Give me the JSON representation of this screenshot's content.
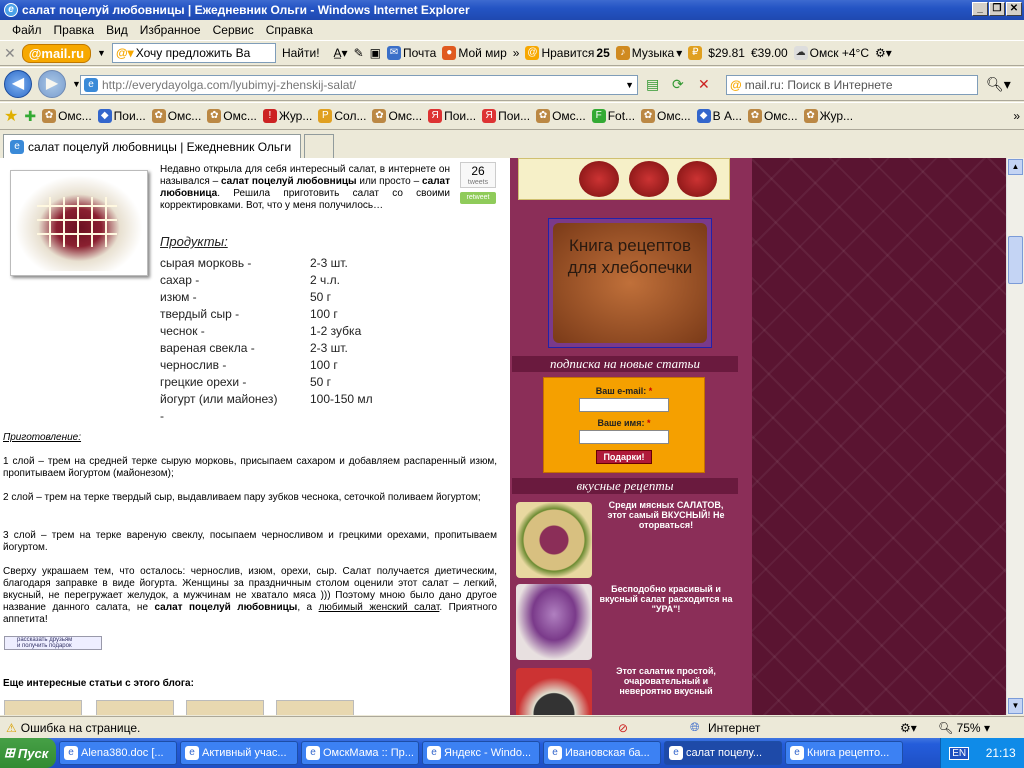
{
  "window": {
    "title": "салат поцелуй любовницы | Ежедневник Ольги - Windows Internet Explorer",
    "minimize": "_",
    "maximize": "❐",
    "close": "✕"
  },
  "menu": [
    "Файл",
    "Правка",
    "Вид",
    "Избранное",
    "Сервис",
    "Справка"
  ],
  "mailbar": {
    "logo": "@mail.ru",
    "search_value": "Хочу предложить Ва",
    "find": "Найти!",
    "pochta": "Почта",
    "moi_mir": "Мой мир",
    "nravitsya": "Нравится",
    "nravitsya_count": "25",
    "muzyka": "Музыка",
    "usd": "$29.81",
    "eur": "€39.00",
    "weather": "Омск +4°C"
  },
  "address": {
    "url_host": "http://everydayolga.com/",
    "url_path": "lyubimyj-zhenskij-salat/",
    "search_placeholder": "mail.ru: Поиск в Интернете"
  },
  "favorites": [
    "Омс...",
    "Пои...",
    "Омс...",
    "Омс...",
    "Жур...",
    "Сол...",
    "Омс...",
    "Пои...",
    "Пои...",
    "Омс...",
    "Fot...",
    "Омс...",
    "В А...",
    "Омс...",
    "Жур..."
  ],
  "tab": {
    "label": "салат поцелуй любовницы | Ежедневник Ольги"
  },
  "article": {
    "intro_a": "Недавно открыла для себя интересный салат, в интернете он назывался – ",
    "intro_b": "салат поцелуй любовницы",
    "intro_c": " или просто – ",
    "intro_d": "салат любовница",
    "intro_e": ". Решила приготовить салат со своими корректировками. Вот, что у меня получилось…",
    "tweet_count": "26",
    "tweet_unit": "tweets",
    "retweet": "retweet",
    "products_title": "Продукты:",
    "products": [
      {
        "name": "сырая морковь -",
        "amount": "2-3 шт."
      },
      {
        "name": "сахар -",
        "amount": "2 ч.л."
      },
      {
        "name": "изюм -",
        "amount": "50 г"
      },
      {
        "name": "твердый сыр -",
        "amount": "100 г"
      },
      {
        "name": "чеснок -",
        "amount": "1-2 зубка"
      },
      {
        "name": "вареная свекла -",
        "amount": "2-3 шт."
      },
      {
        "name": "чернослив -",
        "amount": "100 г"
      },
      {
        "name": "грецкие орехи -",
        "amount": "50 г"
      },
      {
        "name": "йогурт (или майонез)",
        "amount": "100-150 мл"
      },
      {
        "name": "-",
        "amount": ""
      }
    ],
    "prep_title": "Приготовление:",
    "step1": "1 слой – трем на средней терке сырую морковь, присыпаем сахаром и добавляем распаренный изюм, пропитываем йогуртом (майонезом);",
    "step2": "2 слой – трем на терке твердый сыр, выдавливаем пару зубков чеснока, сеточкой поливаем йогуртом;",
    "step3": "3 слой – трем на терке вареную свеклу, посыпаем черносливом и грецкими орехами, пропитываем йогуртом.",
    "final_a": "Сверху украшаем тем, что осталось: чернослив, изюм, орехи, сыр. Салат получается диетическим, благодаря заправке в виде йогурта. Женщины за праздничным столом оценили этот салат – легкий, вкусный, не перегружает желудок, а мужчинам не хватало мяса ))) Поэтому мною было дано другое название данного салата, не ",
    "final_b": "салат поцелуй любовницы",
    "final_c": ", а ",
    "final_d": "любимый женский салат",
    "final_e": ". Приятного аппетита!",
    "share_line1": "рассказать друзьям",
    "share_line2": "и получить подарок",
    "more_title": "Еще интересные статьи с этого блога:"
  },
  "sidebar": {
    "book_banner": "Книга рецептов для хлебопечки",
    "subscribe_head": "подписка на новые статьи",
    "email_label": "Ваш e-mail:",
    "name_label": "Ваше имя:",
    "required_mark": "*",
    "gifts_button": "Подарки!",
    "recipes_head": "вкусные рецепты",
    "recipes": [
      "Среди мясных САЛАТОВ, этот самый ВКУСНЫЙ! Не оторваться!",
      "Бесподобно красивый и вкусный салат расходится на \"УРА\"!",
      "Этот салатик простой, очаровательный и невероятно вкусный"
    ]
  },
  "status": {
    "text": "Ошибка на странице.",
    "zone": "Интернет",
    "zoom": "75%"
  },
  "taskbar": {
    "start": "Пуск",
    "tasks": [
      "Alena380.doc [...",
      "Активный учас...",
      "ОмскМама :: Пр...",
      "Яндекс - Windo...",
      "Ивановская ба...",
      "салат поцелу...",
      "Книга рецепто..."
    ],
    "lang": "EN",
    "clock": "21:13"
  },
  "colors": {
    "sidebar_bg": "#8b2e58",
    "pattern_bg": "#5a1431",
    "form_bg": "#f5a000"
  }
}
